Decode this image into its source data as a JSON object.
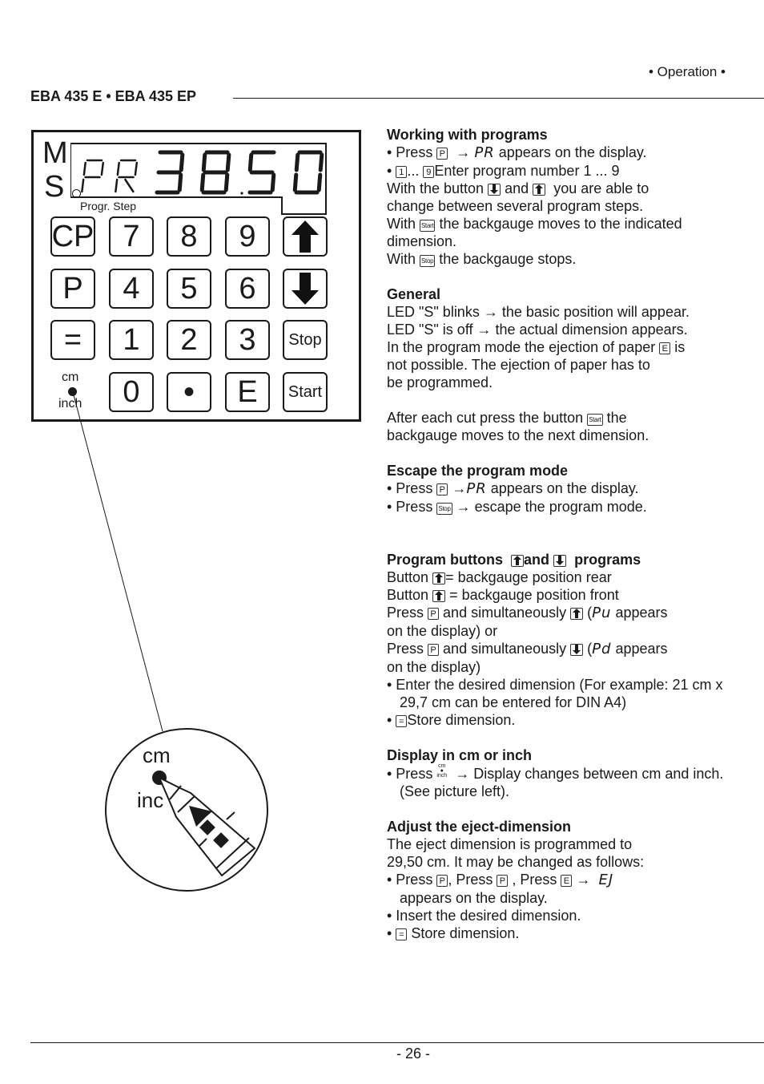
{
  "header": {
    "section": "• Operation •",
    "model": "EBA 435 E • EBA 435 EP"
  },
  "panel": {
    "led_m": "M",
    "led_s": "S",
    "display_text": "PR 38.50",
    "display_prefix": "PR",
    "display_value": "38.50",
    "progr_step_label": "Progr. Step",
    "unit_cm": "cm",
    "unit_inch": "inch",
    "keys": [
      {
        "label": "CP"
      },
      {
        "label": "7"
      },
      {
        "label": "8"
      },
      {
        "label": "9"
      },
      {
        "label": "arrow-up"
      },
      {
        "label": "P"
      },
      {
        "label": "4"
      },
      {
        "label": "5"
      },
      {
        "label": "6"
      },
      {
        "label": "arrow-down"
      },
      {
        "label": "="
      },
      {
        "label": "1"
      },
      {
        "label": "2"
      },
      {
        "label": "3"
      },
      {
        "label": "Stop"
      },
      {
        "label": "0"
      },
      {
        "label": "•"
      },
      {
        "label": "E"
      },
      {
        "label": "Start"
      }
    ]
  },
  "detail": {
    "cm": "cm",
    "inch": "inc"
  },
  "content": {
    "working": {
      "title": "Working with programs",
      "l1a": "• Press",
      "l1key": "P",
      "l1b": "→",
      "l1seg": "PR",
      "l1c": "appears on the display.",
      "l2a": "•",
      "l2k1": "1",
      "l2b": "...",
      "l2k2": "9",
      "l2c": "Enter program number 1 ... 9",
      "l3a": "With the button",
      "l3b": "and",
      "l3c": "you are able to",
      "l4": "change between several program steps.",
      "l5a": "With",
      "l5key": "Start",
      "l5b": "the backgauge moves to the indicated",
      "l6": "dimension.",
      "l7a": "With",
      "l7key": "Stop",
      "l7b": "the  backgauge stops."
    },
    "general": {
      "title": "General",
      "l1": "LED \"S\" blinks → the basic position will appear.",
      "l2": "LED \"S\" is off → the actual dimension appears.",
      "l3a": "In the program mode the ejection of paper",
      "l3key": "E",
      "l3b": "is",
      "l4": "not possible. The ejection of paper has to",
      "l5": "be programmed.",
      "l6a": "After each cut press the button",
      "l6key": "Start",
      "l6b": "the",
      "l7": "backgauge moves to the next dimension."
    },
    "escape": {
      "title": "Escape the program mode",
      "l1a": "• Press",
      "l1key": "P",
      "l1b": "→",
      "l1seg": "PR",
      "l1c": "appears on the display.",
      "l2a": "• Press",
      "l2key": "Stop",
      "l2b": "→ escape the program mode."
    },
    "progbuttons": {
      "title_a": "Program buttons",
      "title_b": "and",
      "title_c": "programs",
      "l1a": "Button",
      "l1b": "= backgauge position rear",
      "l2a": "Button",
      "l2b": " = backgauge position front",
      "l3a": "Press",
      "l3key": "P",
      "l3b": " and simultaneously",
      "l3seg": "Pu",
      "l3c": "appears",
      "l4": "on the display) or",
      "l5a": "Press",
      "l5key": "P",
      "l5b": "and simultaneously",
      "l5seg": "Pd",
      "l5c": "appears",
      "l6": "on the display)",
      "l7": "• Enter the desired dimension (For example: 21 cm x 29,7 cm can be entered for DIN A4)",
      "l8a": "•",
      "l8key": "=",
      "l8b": "Store dimension."
    },
    "cminch": {
      "title": "Display in cm or inch",
      "l1a": "• Press",
      "l1cm": "cm",
      "l1inch": "inch",
      "l1b": "→ Display changes between cm and inch. (See picture left)."
    },
    "eject": {
      "title": "Adjust the eject-dimension",
      "l1": "The eject dimension is programmed to",
      "l2": "29,50 cm. It may be changed as follows:",
      "l3a": "• Press",
      "l3k1": "P",
      "l3b": ", Press",
      "l3k2": "P",
      "l3c": ", Press",
      "l3k3": "E",
      "l3d": "→",
      "l3seg": "EJ",
      "l4": "appears on the display.",
      "l5": "• Insert the desired dimension.",
      "l6a": "•",
      "l6key": "=",
      "l6b": " Store dimension."
    }
  },
  "footer": {
    "page": "- 26 -"
  }
}
